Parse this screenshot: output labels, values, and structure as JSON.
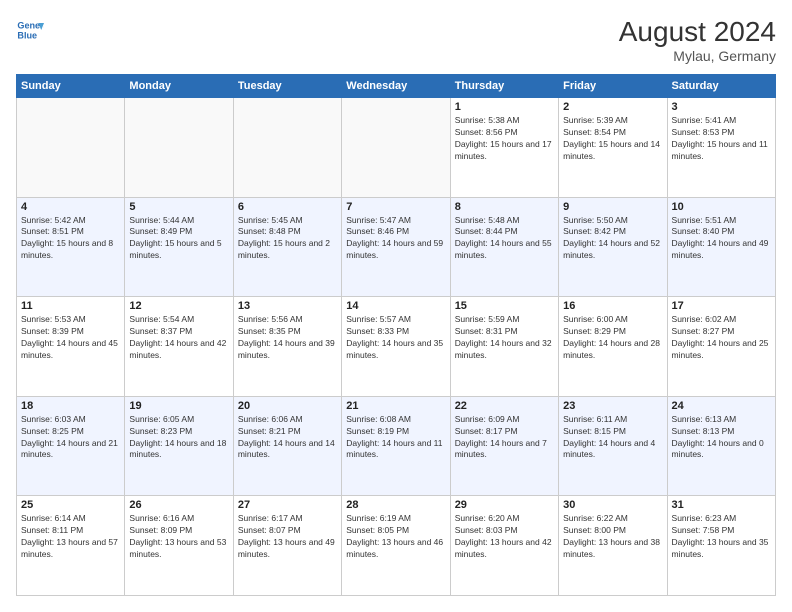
{
  "header": {
    "logo_line1": "General",
    "logo_line2": "Blue",
    "month": "August 2024",
    "location": "Mylau, Germany"
  },
  "weekdays": [
    "Sunday",
    "Monday",
    "Tuesday",
    "Wednesday",
    "Thursday",
    "Friday",
    "Saturday"
  ],
  "weeks": [
    [
      {
        "day": "",
        "info": ""
      },
      {
        "day": "",
        "info": ""
      },
      {
        "day": "",
        "info": ""
      },
      {
        "day": "",
        "info": ""
      },
      {
        "day": "1",
        "info": "Sunrise: 5:38 AM\nSunset: 8:56 PM\nDaylight: 15 hours and 17 minutes."
      },
      {
        "day": "2",
        "info": "Sunrise: 5:39 AM\nSunset: 8:54 PM\nDaylight: 15 hours and 14 minutes."
      },
      {
        "day": "3",
        "info": "Sunrise: 5:41 AM\nSunset: 8:53 PM\nDaylight: 15 hours and 11 minutes."
      }
    ],
    [
      {
        "day": "4",
        "info": "Sunrise: 5:42 AM\nSunset: 8:51 PM\nDaylight: 15 hours and 8 minutes."
      },
      {
        "day": "5",
        "info": "Sunrise: 5:44 AM\nSunset: 8:49 PM\nDaylight: 15 hours and 5 minutes."
      },
      {
        "day": "6",
        "info": "Sunrise: 5:45 AM\nSunset: 8:48 PM\nDaylight: 15 hours and 2 minutes."
      },
      {
        "day": "7",
        "info": "Sunrise: 5:47 AM\nSunset: 8:46 PM\nDaylight: 14 hours and 59 minutes."
      },
      {
        "day": "8",
        "info": "Sunrise: 5:48 AM\nSunset: 8:44 PM\nDaylight: 14 hours and 55 minutes."
      },
      {
        "day": "9",
        "info": "Sunrise: 5:50 AM\nSunset: 8:42 PM\nDaylight: 14 hours and 52 minutes."
      },
      {
        "day": "10",
        "info": "Sunrise: 5:51 AM\nSunset: 8:40 PM\nDaylight: 14 hours and 49 minutes."
      }
    ],
    [
      {
        "day": "11",
        "info": "Sunrise: 5:53 AM\nSunset: 8:39 PM\nDaylight: 14 hours and 45 minutes."
      },
      {
        "day": "12",
        "info": "Sunrise: 5:54 AM\nSunset: 8:37 PM\nDaylight: 14 hours and 42 minutes."
      },
      {
        "day": "13",
        "info": "Sunrise: 5:56 AM\nSunset: 8:35 PM\nDaylight: 14 hours and 39 minutes."
      },
      {
        "day": "14",
        "info": "Sunrise: 5:57 AM\nSunset: 8:33 PM\nDaylight: 14 hours and 35 minutes."
      },
      {
        "day": "15",
        "info": "Sunrise: 5:59 AM\nSunset: 8:31 PM\nDaylight: 14 hours and 32 minutes."
      },
      {
        "day": "16",
        "info": "Sunrise: 6:00 AM\nSunset: 8:29 PM\nDaylight: 14 hours and 28 minutes."
      },
      {
        "day": "17",
        "info": "Sunrise: 6:02 AM\nSunset: 8:27 PM\nDaylight: 14 hours and 25 minutes."
      }
    ],
    [
      {
        "day": "18",
        "info": "Sunrise: 6:03 AM\nSunset: 8:25 PM\nDaylight: 14 hours and 21 minutes."
      },
      {
        "day": "19",
        "info": "Sunrise: 6:05 AM\nSunset: 8:23 PM\nDaylight: 14 hours and 18 minutes."
      },
      {
        "day": "20",
        "info": "Sunrise: 6:06 AM\nSunset: 8:21 PM\nDaylight: 14 hours and 14 minutes."
      },
      {
        "day": "21",
        "info": "Sunrise: 6:08 AM\nSunset: 8:19 PM\nDaylight: 14 hours and 11 minutes."
      },
      {
        "day": "22",
        "info": "Sunrise: 6:09 AM\nSunset: 8:17 PM\nDaylight: 14 hours and 7 minutes."
      },
      {
        "day": "23",
        "info": "Sunrise: 6:11 AM\nSunset: 8:15 PM\nDaylight: 14 hours and 4 minutes."
      },
      {
        "day": "24",
        "info": "Sunrise: 6:13 AM\nSunset: 8:13 PM\nDaylight: 14 hours and 0 minutes."
      }
    ],
    [
      {
        "day": "25",
        "info": "Sunrise: 6:14 AM\nSunset: 8:11 PM\nDaylight: 13 hours and 57 minutes."
      },
      {
        "day": "26",
        "info": "Sunrise: 6:16 AM\nSunset: 8:09 PM\nDaylight: 13 hours and 53 minutes."
      },
      {
        "day": "27",
        "info": "Sunrise: 6:17 AM\nSunset: 8:07 PM\nDaylight: 13 hours and 49 minutes."
      },
      {
        "day": "28",
        "info": "Sunrise: 6:19 AM\nSunset: 8:05 PM\nDaylight: 13 hours and 46 minutes."
      },
      {
        "day": "29",
        "info": "Sunrise: 6:20 AM\nSunset: 8:03 PM\nDaylight: 13 hours and 42 minutes."
      },
      {
        "day": "30",
        "info": "Sunrise: 6:22 AM\nSunset: 8:00 PM\nDaylight: 13 hours and 38 minutes."
      },
      {
        "day": "31",
        "info": "Sunrise: 6:23 AM\nSunset: 7:58 PM\nDaylight: 13 hours and 35 minutes."
      }
    ]
  ]
}
